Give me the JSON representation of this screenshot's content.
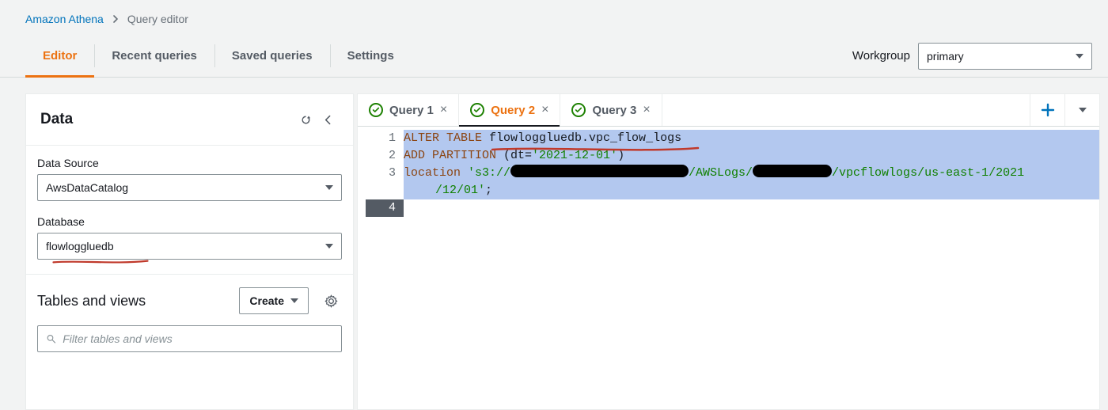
{
  "breadcrumb": {
    "root": "Amazon Athena",
    "current": "Query editor"
  },
  "tabs": {
    "items": [
      "Editor",
      "Recent queries",
      "Saved queries",
      "Settings"
    ],
    "selectedIndex": 0
  },
  "workgroup": {
    "label": "Workgroup",
    "selected": "primary"
  },
  "left": {
    "title": "Data",
    "dataSource": {
      "label": "Data Source",
      "value": "AwsDataCatalog"
    },
    "database": {
      "label": "Database",
      "value": "flowloggluedb"
    },
    "tablesViews": {
      "title": "Tables and views",
      "createLabel": "Create",
      "filterPlaceholder": "Filter tables and views"
    }
  },
  "queryTabs": {
    "items": [
      {
        "name": "Query 1",
        "status": "ok"
      },
      {
        "name": "Query 2",
        "status": "ok"
      },
      {
        "name": "Query 3",
        "status": "ok"
      }
    ],
    "selectedIndex": 1
  },
  "sql": {
    "lines": [
      {
        "n": 1,
        "tokens": [
          [
            "kw",
            "ALTER TABLE "
          ],
          [
            "id",
            "flowloggluedb.vpc_flow_logs"
          ]
        ]
      },
      {
        "n": 2,
        "tokens": [
          [
            "kw",
            "ADD PARTITION "
          ],
          [
            "id",
            "(dt="
          ],
          [
            "str",
            "'2021-12-01'"
          ],
          [
            "id",
            ")"
          ]
        ]
      },
      {
        "n": 3,
        "tokens": [
          [
            "kw",
            "location "
          ],
          [
            "str",
            "'s3://"
          ],
          [
            "redact",
            225
          ],
          [
            "str",
            "/AWSLogs/"
          ],
          [
            "redact",
            100
          ],
          [
            "str",
            "/vpcflowlogs/us-east-1/2021"
          ]
        ]
      },
      {
        "n": "3c",
        "tokens": [
          [
            "str",
            "/12/01'"
          ],
          [
            "id",
            ";"
          ]
        ],
        "continuation": true
      },
      {
        "n": 4,
        "tokens": [],
        "current": true
      }
    ]
  }
}
